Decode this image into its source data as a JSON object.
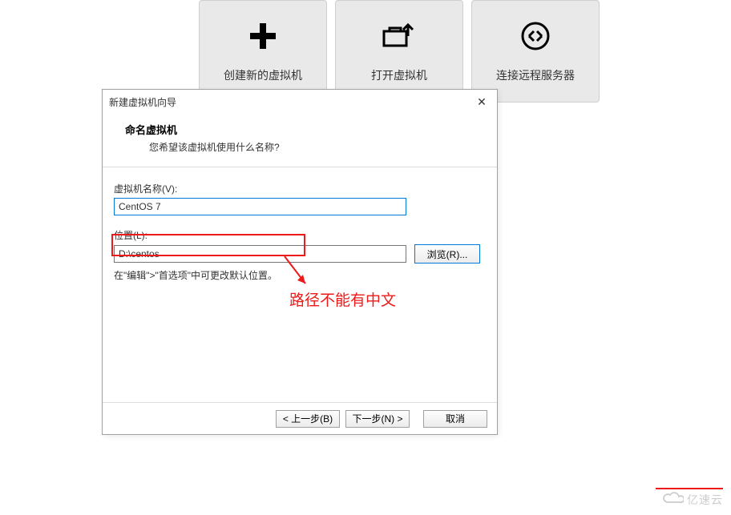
{
  "cards": {
    "create": "创建新的虚拟机",
    "open": "打开虚拟机",
    "connect": "连接远程服务器"
  },
  "dialog": {
    "title": "新建虚拟机向导",
    "headerTitle": "命名虚拟机",
    "headerSub": "您希望该虚拟机使用什么名称?",
    "vmNameLabel": "虚拟机名称(V):",
    "vmNameValue": "CentOS 7",
    "locationLabel": "位置(L):",
    "locationValue": "D:\\centos",
    "browse": "浏览(R)...",
    "hint": "在\"编辑\">\"首选项\"中可更改默认位置。",
    "back": "< 上一步(B)",
    "next": "下一步(N) >",
    "cancel": "取消"
  },
  "annotation": "路径不能有中文",
  "watermark": "亿速云"
}
